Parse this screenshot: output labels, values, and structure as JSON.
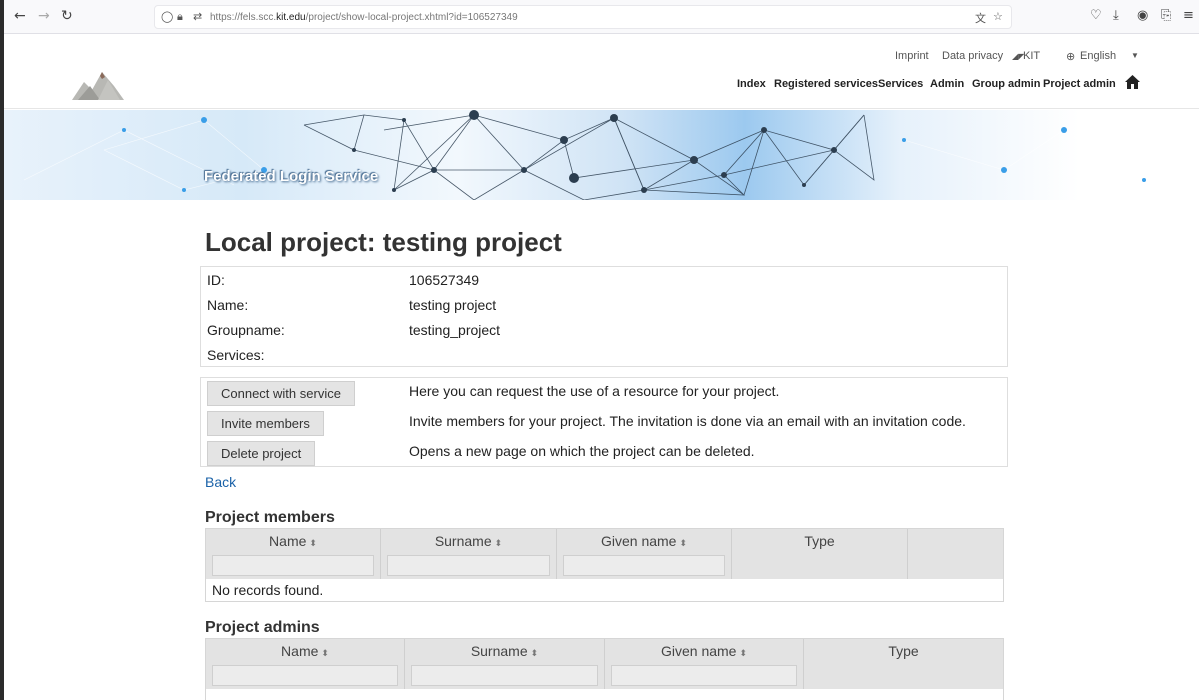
{
  "browser": {
    "url_prefix": "https://fels.scc.",
    "url_domain": "kit.edu",
    "url_path": "/project/show-local-project.xhtml?id=106527349"
  },
  "header": {
    "top_links": {
      "imprint": "Imprint",
      "privacy": "Data privacy",
      "kit": "KIT",
      "language": "English"
    },
    "nav": [
      "Index",
      "Registered services",
      "Services",
      "Admin",
      "Group admin",
      "Project admin"
    ]
  },
  "banner": {
    "title": "Federated Login Service"
  },
  "page": {
    "title": "Local project: testing project",
    "info": {
      "id_label": "ID:",
      "id_value": "106527349",
      "name_label": "Name:",
      "name_value": "testing project",
      "groupname_label": "Groupname:",
      "groupname_value": "testing_project",
      "services_label": "Services:"
    },
    "actions": [
      {
        "label": "Connect with service",
        "description": "Here you can request the use of a resource for your project."
      },
      {
        "label": "Invite members",
        "description": "Invite members for your project. The invitation is done via an email with an invitation code."
      },
      {
        "label": "Delete project",
        "description": "Opens a new page on which the project can be deleted."
      }
    ],
    "back_label": "Back"
  },
  "members": {
    "title": "Project members",
    "columns": [
      "Name",
      "Surname",
      "Given name",
      "Type"
    ],
    "empty_message": "No records found."
  },
  "admins": {
    "title": "Project admins",
    "columns": [
      "Name",
      "Surname",
      "Given name",
      "Type"
    ]
  }
}
